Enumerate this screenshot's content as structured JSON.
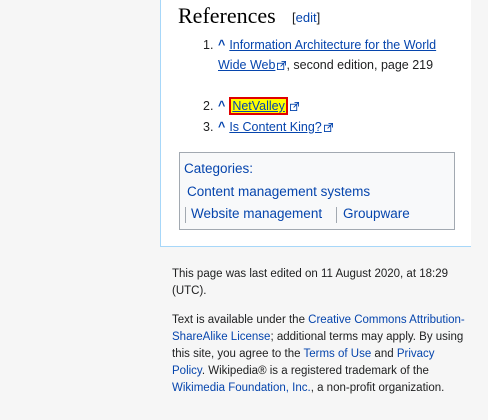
{
  "references": {
    "heading": "References",
    "edit_bracket_open": "[",
    "edit_label": "edit",
    "edit_bracket_close": "]",
    "items": [
      {
        "number": "1.",
        "caret": "^",
        "link": "Information Architecture for the World Wide Web",
        "suffix": ", second edition, page 219"
      },
      {
        "number": "2.",
        "caret": "^",
        "link": "NetValley",
        "suffix": ""
      },
      {
        "number": "3.",
        "caret": "^",
        "link": "Is Content King?",
        "suffix": ""
      }
    ]
  },
  "categories": {
    "title": "Categories:",
    "items": [
      "Content management systems",
      "Website management",
      "Groupware"
    ]
  },
  "footer": {
    "last_edited": "This page was last edited on 11 August 2020, at 18:29 (UTC).",
    "license_1": "Text is available under the ",
    "license_link": "Creative Commons Attribution-ShareAlike License",
    "license_2": "; additional terms may apply. By using this site, you agree to the ",
    "terms_link": "Terms of Use",
    "license_3": " and ",
    "privacy_link": "Privacy Policy",
    "license_4": ". Wikipedia® is a registered trademark of the ",
    "wmf_link": "Wikimedia Foundation, Inc.",
    "license_5": ", a non-profit organization."
  },
  "colors": {
    "link": "#0645ad",
    "highlight": "#ffff00",
    "highlight_border": "#e00000"
  },
  "icons": {
    "external_link": "external-link-icon"
  }
}
